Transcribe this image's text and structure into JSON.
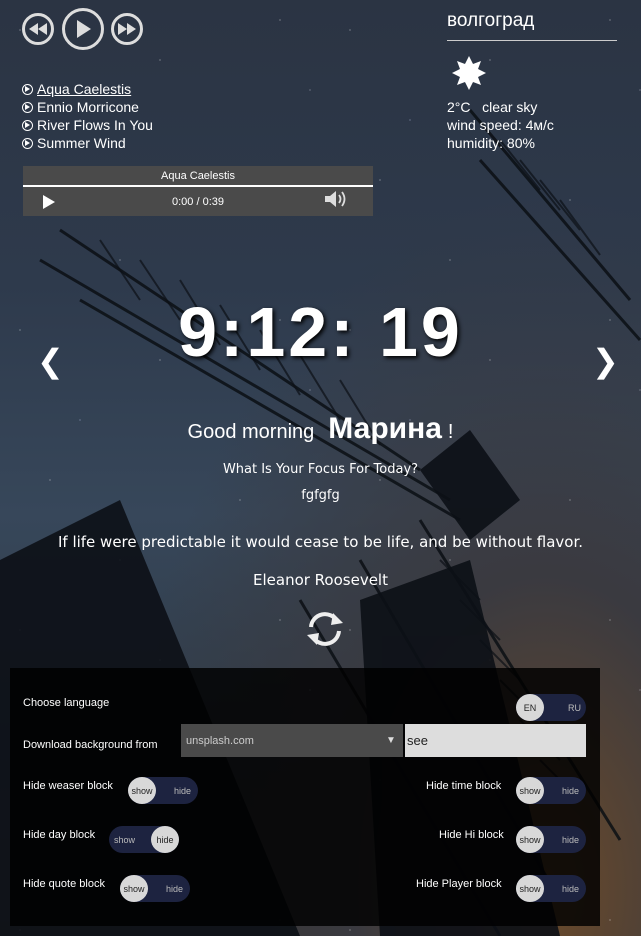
{
  "player": {
    "prev_icon": "rewind-icon",
    "play_icon": "play-icon",
    "next_icon": "fast-forward-icon",
    "tracks": [
      "Aqua Caelestis",
      "Ennio Morricone",
      "River Flows In You",
      "Summer Wind"
    ],
    "audio_title": "Aqua Caelestis",
    "current_time": "0:00",
    "separator": "/",
    "duration": "0:39"
  },
  "weather": {
    "city": "волгоград",
    "temp": "2°C",
    "description": "clear sky",
    "wind": "wind speed: 4м/с",
    "humidity": "humidity: 80%"
  },
  "clock": {
    "time": "9:12: 19"
  },
  "nav": {
    "prev": "❮",
    "next": "❯"
  },
  "greeting": {
    "text": "Good morning",
    "name": "Марина",
    "excl": "!"
  },
  "focus": {
    "question": "What Is Your Focus For Today?",
    "answer": "fgfgfg"
  },
  "quote": {
    "text": "If life were predictable it would cease to be life, and be without flavor.",
    "author": "Eleanor Roosevelt"
  },
  "settings": {
    "choose_language": "Choose language",
    "lang_en": "EN",
    "lang_ru": "RU",
    "download_bg": "Download background from",
    "source": "unsplash.com",
    "dropdown_arrow": "▼",
    "tag": "see",
    "show": "show",
    "hide": "hide",
    "hide_weather": "Hide weaser block",
    "hide_time": "Hide time block",
    "hide_day": "Hide day block",
    "hide_hi": "Hide Hi block",
    "hide_quote": "Hide quote block",
    "hide_player": "Hide Player block"
  }
}
